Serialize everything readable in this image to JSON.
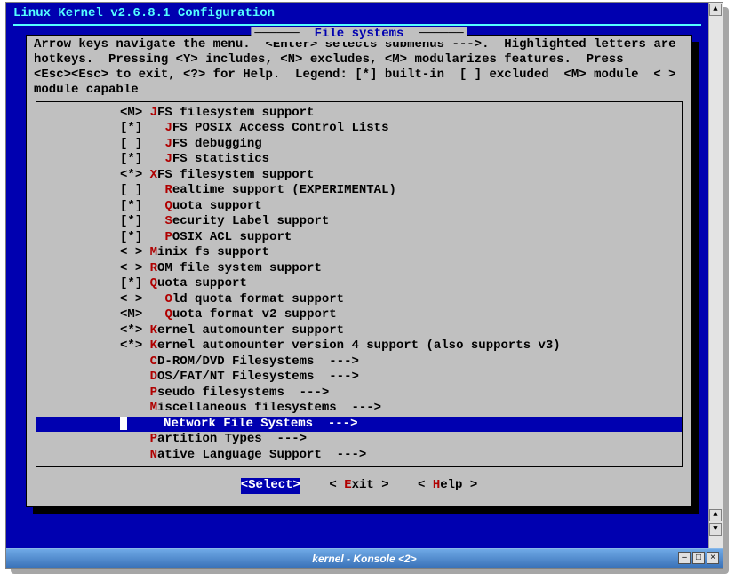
{
  "app_title": " Linux Kernel v2.6.8.1 Configuration ",
  "panel_title": " File systems ",
  "help_lines": "Arrow keys navigate the menu.  <Enter> selects submenus --->.  Highlighted letters are\nhotkeys.  Pressing <Y> includes, <N> excludes, <M> modularizes features.  Press\n<Esc><Esc> to exit, <?> for Help.  Legend: [*] built-in  [ ] excluded  <M> module  < >\nmodule capable",
  "menu": [
    {
      "state": "<M>",
      "indent": 0,
      "hk": "J",
      "label": "FS filesystem support",
      "sel": false
    },
    {
      "state": "[*]",
      "indent": 1,
      "hk": "J",
      "label": "FS POSIX Access Control Lists",
      "sel": false
    },
    {
      "state": "[ ]",
      "indent": 1,
      "hk": "J",
      "label": "FS debugging",
      "sel": false
    },
    {
      "state": "[*]",
      "indent": 1,
      "hk": "J",
      "label": "FS statistics",
      "sel": false
    },
    {
      "state": "<*>",
      "indent": 0,
      "hk": "X",
      "label": "FS filesystem support",
      "sel": false
    },
    {
      "state": "[ ]",
      "indent": 1,
      "hk": "R",
      "label": "ealtime support (EXPERIMENTAL)",
      "sel": false
    },
    {
      "state": "[*]",
      "indent": 1,
      "hk": "Q",
      "label": "uota support",
      "sel": false
    },
    {
      "state": "[*]",
      "indent": 1,
      "hk": "S",
      "label": "ecurity Label support",
      "sel": false
    },
    {
      "state": "[*]",
      "indent": 1,
      "hk": "P",
      "label": "OSIX ACL support",
      "sel": false
    },
    {
      "state": "< >",
      "indent": 0,
      "hk": "M",
      "pre": "",
      "label": "inix fs support",
      "sel": false
    },
    {
      "state": "< >",
      "indent": 0,
      "hk": "R",
      "pre": "",
      "label": "OM file system support",
      "sel": false
    },
    {
      "state": "[*]",
      "indent": 0,
      "hk": "Q",
      "pre": "",
      "label": "uota support",
      "sel": false
    },
    {
      "state": "< >",
      "indent": 1,
      "hk": "O",
      "label": "ld quota format support",
      "sel": false
    },
    {
      "state": "<M>",
      "indent": 1,
      "hk": "Q",
      "label": "uota format v2 support",
      "sel": false
    },
    {
      "state": "<*>",
      "indent": 0,
      "hk": "K",
      "pre": "",
      "label": "ernel automounter support",
      "sel": false
    },
    {
      "state": "<*>",
      "indent": 0,
      "hk": "K",
      "pre": "",
      "label": "ernel automounter version 4 support (also supports v3)",
      "sel": false
    },
    {
      "state": "   ",
      "indent": 0,
      "hk": "C",
      "pre": "",
      "label": "D-ROM/DVD Filesystems  --->",
      "sel": false
    },
    {
      "state": "   ",
      "indent": 0,
      "hk": "D",
      "pre": "",
      "label": "OS/FAT/NT Filesystems  --->",
      "sel": false
    },
    {
      "state": "   ",
      "indent": 0,
      "hk": "P",
      "pre": "",
      "label": "seudo filesystems  --->",
      "sel": false
    },
    {
      "state": "   ",
      "indent": 0,
      "hk": "M",
      "pre": "",
      "label": "iscellaneous filesystems  --->",
      "sel": false
    },
    {
      "state": "   ",
      "indent": 0,
      "hk": "N",
      "pre": "",
      "label": "etwork File Systems  --->",
      "sel": true
    },
    {
      "state": "   ",
      "indent": 0,
      "hk": "P",
      "pre": "",
      "label": "artition Types  --->",
      "sel": false
    },
    {
      "state": "   ",
      "indent": 0,
      "hk": "N",
      "pre": "",
      "label": "ative Language Support  --->",
      "sel": false
    }
  ],
  "buttons": {
    "select": {
      "text": "<Select>",
      "selected": true
    },
    "exit": {
      "lt": "< ",
      "hk": "E",
      "rest": "xit >",
      "selected": false
    },
    "help": {
      "lt": "< ",
      "hk": "H",
      "rest": "elp >",
      "selected": false
    }
  },
  "window_title": "kernel - Konsole <2>",
  "win_controls": {
    "min": "–",
    "max": "□",
    "close": "×"
  }
}
